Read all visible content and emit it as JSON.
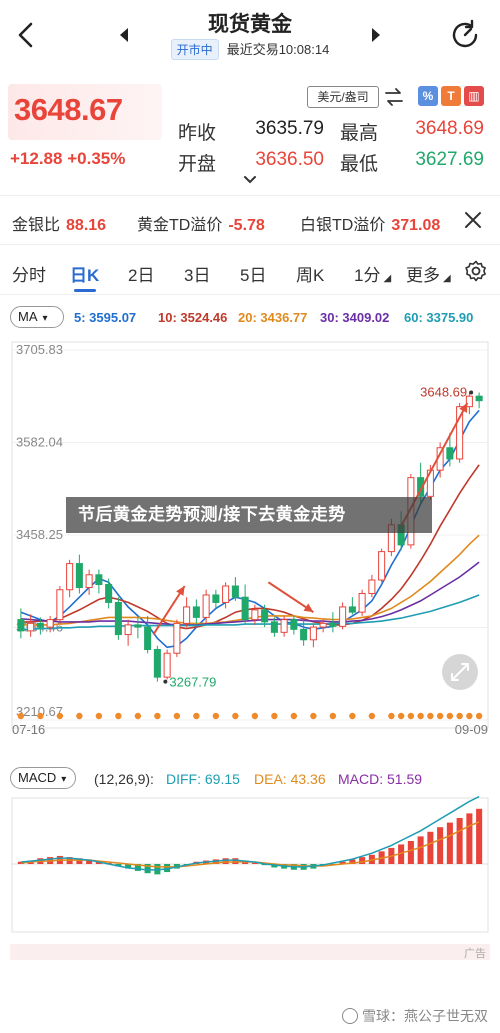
{
  "header": {
    "title": "现货黄金",
    "market_status": "开市中",
    "last_trade_label": "最近交易",
    "last_trade_time": "10:08:14"
  },
  "quote": {
    "price": "3648.67",
    "change": "+12.88",
    "change_pct": "+0.35%",
    "prev_close_label": "昨收",
    "prev_close": "3635.79",
    "open_label": "开盘",
    "open": "3636.50",
    "high_label": "最高",
    "high": "3648.69",
    "low_label": "最低",
    "low": "3627.69",
    "unit": "美元/盎司",
    "up_color": "#e8443a",
    "down_color": "#20a86b"
  },
  "spreads": [
    {
      "label": "金银比",
      "value": "88.16"
    },
    {
      "label": "黄金TD溢价",
      "value": "-5.78"
    },
    {
      "label": "白银TD溢价",
      "value": "371.08"
    }
  ],
  "periods": [
    "分时",
    "日K",
    "2日",
    "3日",
    "5日",
    "周K",
    "1分",
    "更多"
  ],
  "active_period": "日K",
  "ma": {
    "selector": "MA",
    "items": [
      {
        "label": "5: 3595.07",
        "color": "#1f6fd1"
      },
      {
        "label": "10: 3524.46",
        "color": "#c0392b"
      },
      {
        "label": "20: 3436.77",
        "color": "#e08a1e"
      },
      {
        "label": "30: 3409.02",
        "color": "#6a2fa5"
      },
      {
        "label": "60: 3375.90",
        "color": "#1e9db3"
      }
    ]
  },
  "news_banner": "节后黄金走势预测/接下去黄金走势",
  "chart_data": {
    "type": "candlestick",
    "y_ticks": [
      "3705.83",
      "3582.04",
      "3458.25",
      "3334.46",
      "3210.67"
    ],
    "x_labels": [
      "07-16",
      "09-09"
    ],
    "annotations": {
      "high": "3648.69",
      "low": "3267.79"
    },
    "ohlc": [
      [
        3345,
        3360,
        3320,
        3330
      ],
      [
        3330,
        3352,
        3322,
        3340
      ],
      [
        3340,
        3348,
        3325,
        3335
      ],
      [
        3335,
        3350,
        3328,
        3345
      ],
      [
        3345,
        3390,
        3340,
        3385
      ],
      [
        3385,
        3425,
        3375,
        3420
      ],
      [
        3420,
        3432,
        3380,
        3388
      ],
      [
        3388,
        3412,
        3378,
        3405
      ],
      [
        3405,
        3412,
        3380,
        3392
      ],
      [
        3392,
        3400,
        3360,
        3368
      ],
      [
        3368,
        3375,
        3318,
        3325
      ],
      [
        3325,
        3345,
        3310,
        3338
      ],
      [
        3338,
        3348,
        3320,
        3335
      ],
      [
        3335,
        3350,
        3300,
        3305
      ],
      [
        3305,
        3310,
        3262,
        3268
      ],
      [
        3268,
        3305,
        3265,
        3300
      ],
      [
        3300,
        3345,
        3295,
        3340
      ],
      [
        3340,
        3375,
        3335,
        3362
      ],
      [
        3362,
        3372,
        3340,
        3348
      ],
      [
        3348,
        3385,
        3340,
        3378
      ],
      [
        3378,
        3385,
        3360,
        3368
      ],
      [
        3368,
        3395,
        3360,
        3390
      ],
      [
        3390,
        3402,
        3370,
        3375
      ],
      [
        3375,
        3392,
        3340,
        3345
      ],
      [
        3345,
        3365,
        3338,
        3358
      ],
      [
        3358,
        3365,
        3335,
        3342
      ],
      [
        3342,
        3348,
        3322,
        3328
      ],
      [
        3328,
        3350,
        3322,
        3345
      ],
      [
        3345,
        3350,
        3325,
        3332
      ],
      [
        3332,
        3345,
        3310,
        3318
      ],
      [
        3318,
        3340,
        3308,
        3335
      ],
      [
        3335,
        3345,
        3328,
        3340
      ],
      [
        3340,
        3355,
        3328,
        3336
      ],
      [
        3336,
        3368,
        3332,
        3362
      ],
      [
        3362,
        3375,
        3352,
        3355
      ],
      [
        3355,
        3385,
        3350,
        3380
      ],
      [
        3380,
        3405,
        3375,
        3398
      ],
      [
        3398,
        3440,
        3395,
        3436
      ],
      [
        3436,
        3480,
        3430,
        3472
      ],
      [
        3472,
        3490,
        3438,
        3445
      ],
      [
        3445,
        3540,
        3440,
        3535
      ],
      [
        3535,
        3555,
        3500,
        3510
      ],
      [
        3510,
        3552,
        3505,
        3545
      ],
      [
        3545,
        3582,
        3535,
        3575
      ],
      [
        3575,
        3595,
        3550,
        3560
      ],
      [
        3560,
        3635,
        3555,
        3630
      ],
      [
        3630,
        3648,
        3620,
        3644
      ],
      [
        3644,
        3649,
        3628,
        3638
      ]
    ],
    "ma_series": [
      {
        "name": "5",
        "color": "#1f6fd1",
        "values": [
          3355,
          3350,
          3345,
          3342,
          3350,
          3362,
          3375,
          3388,
          3400,
          3395,
          3378,
          3362,
          3350,
          3338,
          3320,
          3308,
          3310,
          3320,
          3335,
          3348,
          3360,
          3368,
          3375,
          3372,
          3368,
          3360,
          3350,
          3342,
          3340,
          3335,
          3332,
          3334,
          3336,
          3342,
          3350,
          3358,
          3370,
          3392,
          3418,
          3440,
          3470,
          3500,
          3522,
          3545,
          3560,
          3585,
          3610,
          3625
        ]
      },
      {
        "name": "10",
        "color": "#c0392b",
        "values": [
          3342,
          3342,
          3343,
          3343,
          3346,
          3352,
          3358,
          3365,
          3372,
          3375,
          3372,
          3368,
          3362,
          3356,
          3348,
          3340,
          3335,
          3333,
          3335,
          3338,
          3342,
          3348,
          3355,
          3358,
          3360,
          3360,
          3358,
          3355,
          3350,
          3346,
          3342,
          3340,
          3338,
          3338,
          3340,
          3344,
          3350,
          3360,
          3372,
          3386,
          3404,
          3424,
          3446,
          3470,
          3492,
          3514,
          3534,
          3552
        ]
      },
      {
        "name": "20",
        "color": "#e08a1e",
        "values": [
          3338,
          3338,
          3338,
          3338,
          3339,
          3340,
          3342,
          3344,
          3346,
          3348,
          3348,
          3348,
          3348,
          3347,
          3346,
          3344,
          3342,
          3340,
          3340,
          3340,
          3341,
          3342,
          3344,
          3346,
          3348,
          3350,
          3350,
          3350,
          3350,
          3348,
          3347,
          3346,
          3345,
          3345,
          3346,
          3348,
          3350,
          3355,
          3360,
          3368,
          3376,
          3386,
          3396,
          3408,
          3420,
          3432,
          3446,
          3458
        ]
      },
      {
        "name": "30",
        "color": "#6a2fa5",
        "values": [
          3346,
          3345,
          3344,
          3343,
          3342,
          3342,
          3342,
          3342,
          3343,
          3343,
          3343,
          3343,
          3342,
          3341,
          3340,
          3339,
          3338,
          3338,
          3338,
          3339,
          3340,
          3341,
          3342,
          3343,
          3344,
          3345,
          3345,
          3345,
          3345,
          3344,
          3343,
          3343,
          3342,
          3342,
          3343,
          3344,
          3346,
          3349,
          3353,
          3358,
          3364,
          3370,
          3378,
          3386,
          3394,
          3402,
          3412,
          3422
        ]
      },
      {
        "name": "60",
        "color": "#1e9db3",
        "values": [
          3332,
          3332,
          3333,
          3333,
          3334,
          3334,
          3335,
          3335,
          3336,
          3336,
          3336,
          3337,
          3337,
          3337,
          3337,
          3337,
          3337,
          3337,
          3337,
          3338,
          3338,
          3338,
          3338,
          3339,
          3339,
          3339,
          3339,
          3339,
          3339,
          3339,
          3339,
          3339,
          3340,
          3340,
          3340,
          3341,
          3342,
          3343,
          3345,
          3347,
          3350,
          3353,
          3356,
          3360,
          3364,
          3368,
          3373,
          3378
        ]
      }
    ]
  },
  "macd": {
    "selector": "MACD",
    "params": "(12,26,9):",
    "diff": "DIFF: 69.15",
    "dea": "DEA: 43.36",
    "macd": "MACD: 51.59",
    "diff_color": "#1e9db3",
    "dea_color": "#e08a1e",
    "macd_color": "#8a2fa5",
    "bars": [
      2,
      3,
      5,
      6,
      7,
      6,
      5,
      4,
      2,
      1,
      -2,
      -4,
      -6,
      -8,
      -9,
      -7,
      -4,
      -1,
      2,
      3,
      4,
      5,
      5,
      3,
      1,
      -1,
      -3,
      -4,
      -5,
      -5,
      -4,
      -2,
      0,
      2,
      4,
      6,
      8,
      11,
      14,
      17,
      20,
      24,
      28,
      32,
      36,
      40,
      44,
      48
    ],
    "diff_line": [
      2,
      3,
      4,
      5,
      6,
      6,
      5,
      4,
      2,
      0,
      -2,
      -4,
      -5,
      -6,
      -6,
      -5,
      -3,
      -1,
      1,
      2,
      3,
      4,
      4,
      3,
      2,
      0,
      -1,
      -2,
      -3,
      -3,
      -2,
      -1,
      1,
      3,
      5,
      8,
      11,
      15,
      19,
      24,
      29,
      34,
      40,
      46,
      52,
      58,
      64,
      69
    ],
    "dea_line": [
      1,
      2,
      3,
      3,
      4,
      4,
      4,
      4,
      3,
      2,
      1,
      0,
      -1,
      -2,
      -3,
      -3,
      -3,
      -2,
      -1,
      0,
      1,
      2,
      2,
      2,
      2,
      1,
      0,
      -1,
      -1,
      -2,
      -2,
      -2,
      -1,
      0,
      1,
      2,
      4,
      6,
      8,
      11,
      14,
      17,
      21,
      25,
      29,
      34,
      39,
      43
    ]
  },
  "ad_label": "广告",
  "watermark": "雪球：燕公子世无双"
}
